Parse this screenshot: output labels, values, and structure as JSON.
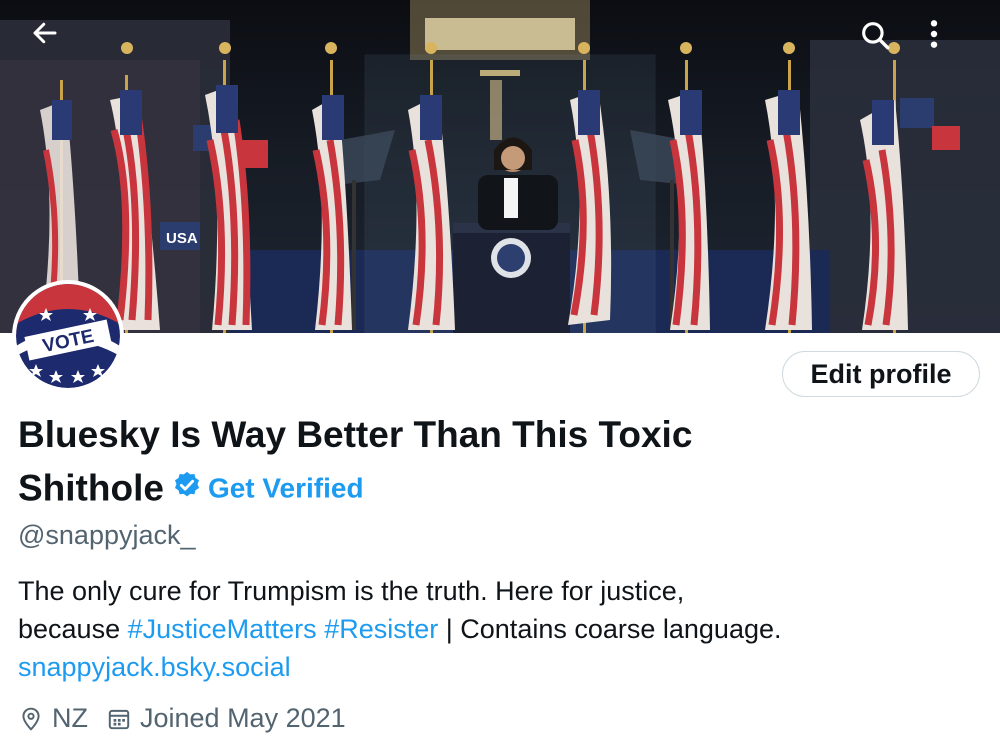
{
  "nav": {
    "back_icon": "arrow-left-icon",
    "search_icon": "search-icon",
    "more_icon": "more-vertical-icon"
  },
  "banner": {
    "description_icon": "rally-photo",
    "sign_text": "USA"
  },
  "avatar": {
    "text": "VOTE"
  },
  "edit_profile_label": "Edit profile",
  "profile": {
    "name_line1": "Bluesky Is Way Better Than This Toxic",
    "name_line2": "Shithole",
    "get_verified": "Get Verified",
    "handle": "@snappyjack_",
    "bio_part1": "The only cure for Trumpism is the truth. Here for justice,",
    "bio_part2": "because",
    "hashtag1": "#JusticeMatters",
    "hashtag2": "#Resister",
    "bio_part3": "| Contains coarse language.",
    "link": "snappyjack.bsky.social",
    "location": "NZ",
    "joined": "Joined May 2021"
  },
  "colors": {
    "accent": "#1d9bf0",
    "secondary_text": "#536471",
    "text": "#0f1419"
  }
}
